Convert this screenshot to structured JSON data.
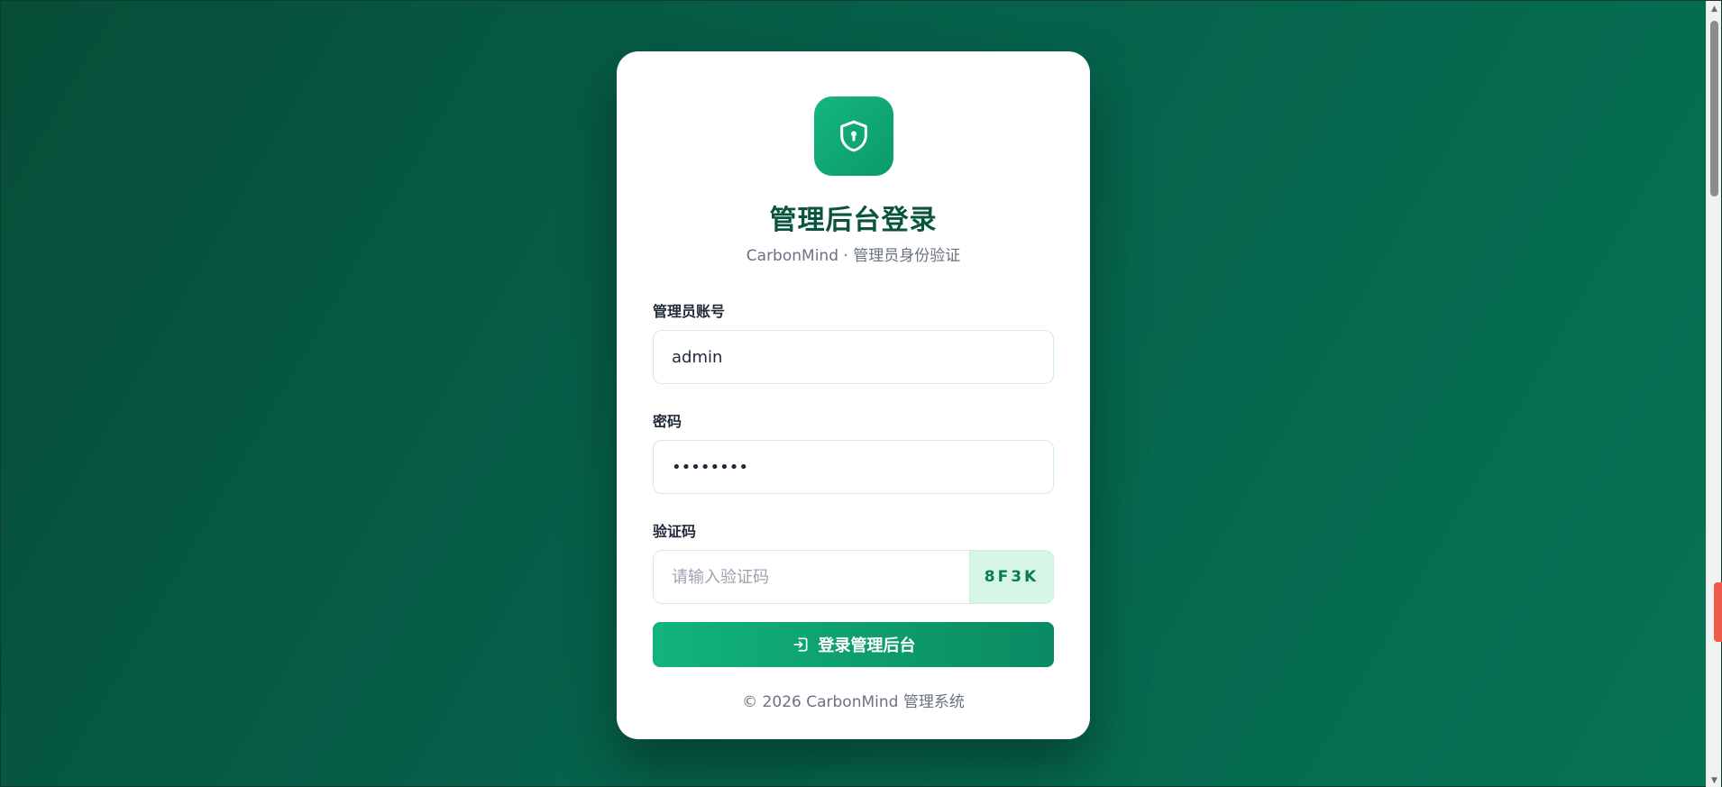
{
  "login": {
    "title": "管理后台登录",
    "subtitle": "CarbonMind · 管理员身份验证",
    "account_label": "管理员账号",
    "account_value": "admin",
    "password_label": "密码",
    "password_value": "password",
    "captcha_label": "验证码",
    "captcha_placeholder": "请输入验证码",
    "captcha_code": "8F3K",
    "submit_label": "登录管理后台",
    "footer": "© 2026 CarbonMind 管理系统"
  },
  "icons": {
    "logo": "shield-lock-icon",
    "submit": "login-icon"
  },
  "colors": {
    "background_dark": "#074d38",
    "background_light": "#067354",
    "accent": "#10b37d",
    "title": "#08543e",
    "captcha_bg": "#d5f5e7",
    "captcha_text": "#0b7a56"
  }
}
